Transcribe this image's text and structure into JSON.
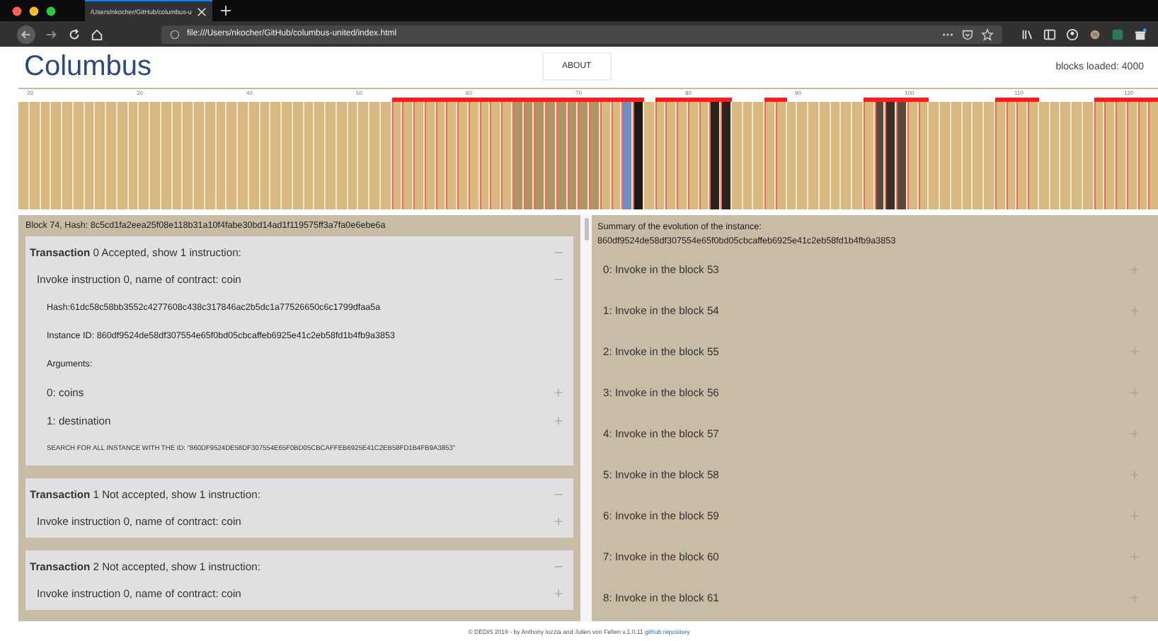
{
  "browser": {
    "tab_title": "/Users/nkocher/GitHub/columbus-u",
    "url": "file:///Users/nkocher/GitHub/columbus-united/index.html"
  },
  "header": {
    "title": "Columbus",
    "about_button": "ABOUT",
    "blocks_loaded": "blocks loaded: 4000"
  },
  "ruler_ticks": [
    "20",
    "30",
    "40",
    "50",
    "60",
    "70",
    "80",
    "90",
    "100",
    "110",
    "120"
  ],
  "blocks": [
    {
      "color": "#d9b982",
      "marked": false
    },
    {
      "color": "#d9b982",
      "marked": false
    },
    {
      "color": "#d9b982",
      "marked": false
    },
    {
      "color": "#d9b982",
      "marked": false
    },
    {
      "color": "#d9b982",
      "marked": false
    },
    {
      "color": "#d9b982",
      "marked": false
    },
    {
      "color": "#d9b982",
      "marked": false
    },
    {
      "color": "#d9b982",
      "marked": false
    },
    {
      "color": "#d9b982",
      "marked": false
    },
    {
      "color": "#d9b982",
      "marked": false
    },
    {
      "color": "#d9b982",
      "marked": false
    },
    {
      "color": "#d9b982",
      "marked": false
    },
    {
      "color": "#d9b982",
      "marked": false
    },
    {
      "color": "#d9b982",
      "marked": false
    },
    {
      "color": "#d9b982",
      "marked": false
    },
    {
      "color": "#d9b982",
      "marked": false
    },
    {
      "color": "#d9b982",
      "marked": false
    },
    {
      "color": "#d9b982",
      "marked": false
    },
    {
      "color": "#d9b982",
      "marked": false
    },
    {
      "color": "#d9b982",
      "marked": false
    },
    {
      "color": "#d9b982",
      "marked": false
    },
    {
      "color": "#d9b982",
      "marked": false
    },
    {
      "color": "#d9b982",
      "marked": false
    },
    {
      "color": "#d9b982",
      "marked": false
    },
    {
      "color": "#d9b982",
      "marked": false
    },
    {
      "color": "#d9b982",
      "marked": false
    },
    {
      "color": "#d9b982",
      "marked": false
    },
    {
      "color": "#d9b982",
      "marked": false
    },
    {
      "color": "#d9b982",
      "marked": false
    },
    {
      "color": "#d9b982",
      "marked": false
    },
    {
      "color": "#d9b982",
      "marked": false
    },
    {
      "color": "#d9b982",
      "marked": false
    },
    {
      "color": "#d9b982",
      "marked": false
    },
    {
      "color": "#d9b982",
      "marked": false
    },
    {
      "color": "#d9b982",
      "marked": true
    },
    {
      "color": "#d9b982",
      "marked": true
    },
    {
      "color": "#d9b982",
      "marked": true
    },
    {
      "color": "#d9b982",
      "marked": true
    },
    {
      "color": "#d9b982",
      "marked": true
    },
    {
      "color": "#d9b982",
      "marked": true
    },
    {
      "color": "#d9b982",
      "marked": true
    },
    {
      "color": "#d9b982",
      "marked": true
    },
    {
      "color": "#d9b982",
      "marked": true
    },
    {
      "color": "#d9b982",
      "marked": true
    },
    {
      "color": "#d9b982",
      "marked": true
    },
    {
      "color": "#b09466",
      "marked": true
    },
    {
      "color": "#b09466",
      "marked": true
    },
    {
      "color": "#b09466",
      "marked": true
    },
    {
      "color": "#b09466",
      "marked": true
    },
    {
      "color": "#b09466",
      "marked": true
    },
    {
      "color": "#b09466",
      "marked": true
    },
    {
      "color": "#b09466",
      "marked": true
    },
    {
      "color": "#b09466",
      "marked": true
    },
    {
      "color": "#d9b982",
      "marked": true
    },
    {
      "color": "#d9b982",
      "marked": true
    },
    {
      "color": "#6f8dc2",
      "marked": true
    },
    {
      "color": "#1c1816",
      "marked": true
    },
    {
      "color": "#d9b982",
      "marked": false
    },
    {
      "color": "#d9b982",
      "marked": true
    },
    {
      "color": "#d9b982",
      "marked": true
    },
    {
      "color": "#d9b982",
      "marked": true
    },
    {
      "color": "#d9b982",
      "marked": true
    },
    {
      "color": "#d9b982",
      "marked": true
    },
    {
      "color": "#2b241e",
      "marked": true
    },
    {
      "color": "#2b241e",
      "marked": true
    },
    {
      "color": "#d9b982",
      "marked": false
    },
    {
      "color": "#d9b982",
      "marked": false
    },
    {
      "color": "#d9b982",
      "marked": false
    },
    {
      "color": "#d9b982",
      "marked": true
    },
    {
      "color": "#d9b982",
      "marked": true
    },
    {
      "color": "#d9b982",
      "marked": false
    },
    {
      "color": "#d9b982",
      "marked": false
    },
    {
      "color": "#d9b982",
      "marked": false
    },
    {
      "color": "#d9b982",
      "marked": false
    },
    {
      "color": "#d9b982",
      "marked": false
    },
    {
      "color": "#d9b982",
      "marked": false
    },
    {
      "color": "#d9b982",
      "marked": false
    },
    {
      "color": "#d9b982",
      "marked": true
    },
    {
      "color": "#5a4a3c",
      "marked": true
    },
    {
      "color": "#3a2f28",
      "marked": true
    },
    {
      "color": "#5a4a3c",
      "marked": true
    },
    {
      "color": "#d9b982",
      "marked": true
    },
    {
      "color": "#d9b982",
      "marked": true
    },
    {
      "color": "#d9b982",
      "marked": false
    },
    {
      "color": "#d9b982",
      "marked": false
    },
    {
      "color": "#d9b982",
      "marked": false
    },
    {
      "color": "#d9b982",
      "marked": false
    },
    {
      "color": "#d9b982",
      "marked": false
    },
    {
      "color": "#d9b982",
      "marked": false
    },
    {
      "color": "#d9b982",
      "marked": true
    },
    {
      "color": "#d9b982",
      "marked": true
    },
    {
      "color": "#d9b982",
      "marked": true
    },
    {
      "color": "#d9b982",
      "marked": true
    },
    {
      "color": "#d9b982",
      "marked": false
    },
    {
      "color": "#d9b982",
      "marked": false
    },
    {
      "color": "#d9b982",
      "marked": false
    },
    {
      "color": "#d9b982",
      "marked": false
    },
    {
      "color": "#d9b982",
      "marked": false
    },
    {
      "color": "#d9b982",
      "marked": true
    },
    {
      "color": "#d9b982",
      "marked": true
    },
    {
      "color": "#d9b982",
      "marked": true
    },
    {
      "color": "#d9b982",
      "marked": true
    },
    {
      "color": "#d9b982",
      "marked": true
    },
    {
      "color": "#d9b982",
      "marked": true
    }
  ],
  "block_panel": {
    "heading": "Block 74, Hash: 8c5cd1fa2eea25f08e118b31a10f4fabe30bd14ad1f119575ff3a7fa0e6ebe6a",
    "transactions": [
      {
        "title": "**Transaction** 0 Accepted, show 1 instruction:",
        "expanded": true,
        "instructions": [
          {
            "label": "Invoke instruction 0, name of contract: coin",
            "expanded": true,
            "hash": "Hash:61dc58c58bb3552c4277608c438c317846ac2b5dc1a77526650c6c1799dfaa5a",
            "instance_id": "Instance ID: 860df9524de58df307554e65f0bd05cbcaffeb6925e41c2eb58fd1b4fb9a3853",
            "arguments_label": "Arguments:",
            "arguments": [
              {
                "label": "0: coins",
                "expanded": false
              },
              {
                "label": "1: destination",
                "expanded": false
              }
            ],
            "search_link": "SEARCH FOR ALL INSTANCE WITH THE ID: \"860DF9524DE58DF307554E65F0BD05CBCAFFEB6925E41C2EB58FD1B4FB9A3853\""
          }
        ]
      },
      {
        "title": "**Transaction** 1 Not accepted, show 1 instruction:",
        "expanded": true,
        "instructions": [
          {
            "label": "Invoke instruction 0, name of contract: coin",
            "expanded": false
          }
        ]
      },
      {
        "title": "**Transaction** 2 Not accepted, show 1 instruction:",
        "expanded": true,
        "instructions": [
          {
            "label": "Invoke instruction 0, name of contract: coin",
            "expanded": false
          }
        ]
      }
    ]
  },
  "summary_panel": {
    "heading": "Summary of the evolution of the instance:",
    "instance_id": "860df9524de58df307554e65f0bd05cbcaffeb6925e41c2eb58fd1b4fb9a3853",
    "items": [
      {
        "label": "0: Invoke in the block 53",
        "expanded": false
      },
      {
        "label": "1: Invoke in the block 54",
        "expanded": false
      },
      {
        "label": "2: Invoke in the block 55",
        "expanded": false
      },
      {
        "label": "3: Invoke in the block 56",
        "expanded": false
      },
      {
        "label": "4: Invoke in the block 57",
        "expanded": false
      },
      {
        "label": "5: Invoke in the block 58",
        "expanded": false
      },
      {
        "label": "6: Invoke in the block 59",
        "expanded": false
      },
      {
        "label": "7: Invoke in the block 60",
        "expanded": false
      },
      {
        "label": "8: Invoke in the block 61",
        "expanded": false
      }
    ]
  },
  "footer": {
    "text": "© DEDIS 2019 - by Anthony Iozzia and Julien von Felten v.1.0.11",
    "link": "github repository"
  }
}
